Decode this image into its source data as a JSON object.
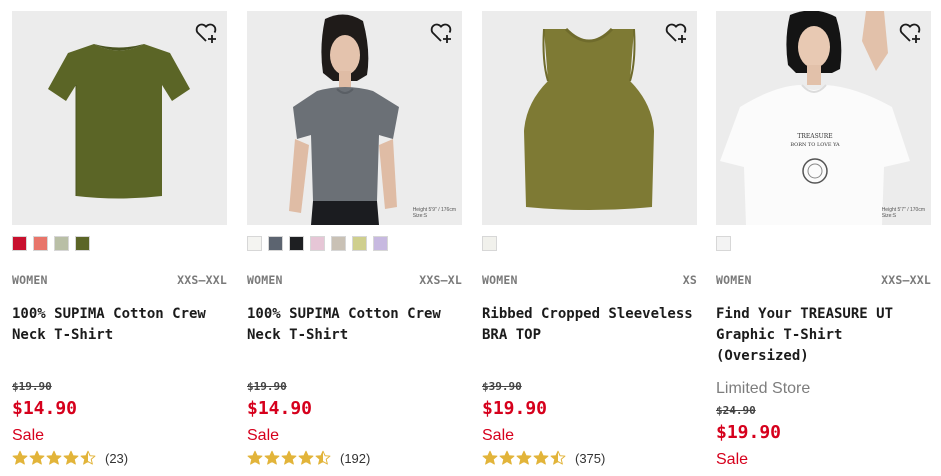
{
  "colors": {
    "price_red": "#d6001c",
    "star_gold": "#e2b43a"
  },
  "products": [
    {
      "gender": "WOMEN",
      "size_range": "XXS–XXL",
      "name_line1": "100% SUPIMA Cotton Crew",
      "name_line2": "Neck T-Shirt",
      "store_note": "",
      "image_note_line1": "",
      "image_note_line2": "",
      "swatches": [
        "#c8102e",
        "#e8756a",
        "#b9bfa6",
        "#5b6526"
      ],
      "old_price": "$19.90",
      "price": "$14.90",
      "sale_label": "Sale",
      "rating": 4.5,
      "reviews": "(23)"
    },
    {
      "gender": "WOMEN",
      "size_range": "XXS–XL",
      "name_line1": "100% SUPIMA Cotton Crew",
      "name_line2": "Neck T-Shirt",
      "store_note": "",
      "image_note_line1": "Height 5'9\" / 176cm",
      "image_note_line2": "Size:S",
      "swatches": [
        "#f4f4f1",
        "#5c6470",
        "#1e1f22",
        "#e6c6d6",
        "#c9c1b5",
        "#cfcf8e",
        "#c7b9e0"
      ],
      "old_price": "$19.90",
      "price": "$14.90",
      "sale_label": "Sale",
      "rating": 4.5,
      "reviews": "(192)"
    },
    {
      "gender": "WOMEN",
      "size_range": "XS",
      "name_line1": "Ribbed Cropped Sleeveless",
      "name_line2": "BRA TOP",
      "store_note": "",
      "image_note_line1": "",
      "image_note_line2": "",
      "swatches": [
        "#f1f1ec"
      ],
      "old_price": "$39.90",
      "price": "$19.90",
      "sale_label": "Sale",
      "rating": 4.5,
      "reviews": "(375)"
    },
    {
      "gender": "WOMEN",
      "size_range": "XXS–XXL",
      "name_line1": "Find Your TREASURE UT",
      "name_line2": "Graphic T-Shirt (Oversized)",
      "store_note": "Limited Store",
      "image_note_line1": "Height 5'7\" / 170cm",
      "image_note_line2": "Size:S",
      "shirt_print_line1": "TREASURE",
      "shirt_print_line2": "BORN TO LOVE YA",
      "swatches": [
        "#f3f3f3"
      ],
      "old_price": "$24.90",
      "price": "$19.90",
      "sale_label": "Sale",
      "rating": null,
      "reviews": ""
    }
  ]
}
